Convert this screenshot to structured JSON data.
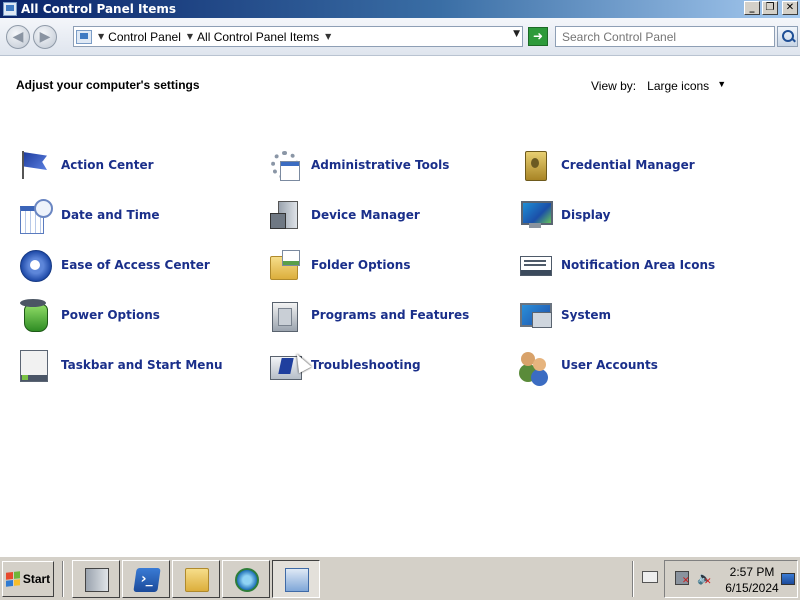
{
  "window": {
    "title": "All Control Panel Items",
    "buttons": {
      "minimize": "_",
      "restore": "❐",
      "close": "✕"
    }
  },
  "address_bar": {
    "breadcrumbs": [
      "Control Panel",
      "All Control Panel Items"
    ],
    "search_placeholder": "Search Control Panel"
  },
  "content": {
    "heading": "Adjust your computer's settings",
    "view_by_label": "View by:",
    "view_by_value": "Large icons"
  },
  "items": [
    {
      "label": "Action Center",
      "icon": "action-center-flag-icon"
    },
    {
      "label": "Administrative Tools",
      "icon": "administrative-tools-icon"
    },
    {
      "label": "Credential Manager",
      "icon": "credential-manager-vault-icon"
    },
    {
      "label": "Date and Time",
      "icon": "date-and-time-calendar-clock-icon"
    },
    {
      "label": "Device Manager",
      "icon": "device-manager-icon"
    },
    {
      "label": "Display",
      "icon": "display-monitor-icon"
    },
    {
      "label": "Ease of Access Center",
      "icon": "ease-of-access-icon"
    },
    {
      "label": "Folder Options",
      "icon": "folder-options-icon"
    },
    {
      "label": "Notification Area Icons",
      "icon": "notification-area-icon"
    },
    {
      "label": "Power Options",
      "icon": "power-options-battery-icon"
    },
    {
      "label": "Programs and Features",
      "icon": "programs-and-features-icon"
    },
    {
      "label": "System",
      "icon": "system-computer-icon"
    },
    {
      "label": "Taskbar and Start Menu",
      "icon": "taskbar-start-menu-icon"
    },
    {
      "label": "Troubleshooting",
      "icon": "troubleshooting-icon"
    },
    {
      "label": "User Accounts",
      "icon": "user-accounts-icon"
    }
  ],
  "taskbar": {
    "start_label": "Start",
    "pinned": [
      "server-manager-icon",
      "powershell-icon",
      "windows-explorer-icon",
      "internet-explorer-icon",
      "control-panel-icon"
    ],
    "active_index": 4,
    "clock_time": "2:57 PM",
    "clock_date": "6/15/2024"
  },
  "colors": {
    "link": "#1a2f8a",
    "titlebar_start": "#0a246a",
    "titlebar_end": "#a6caf0",
    "taskbar": "#d4d0c8"
  }
}
